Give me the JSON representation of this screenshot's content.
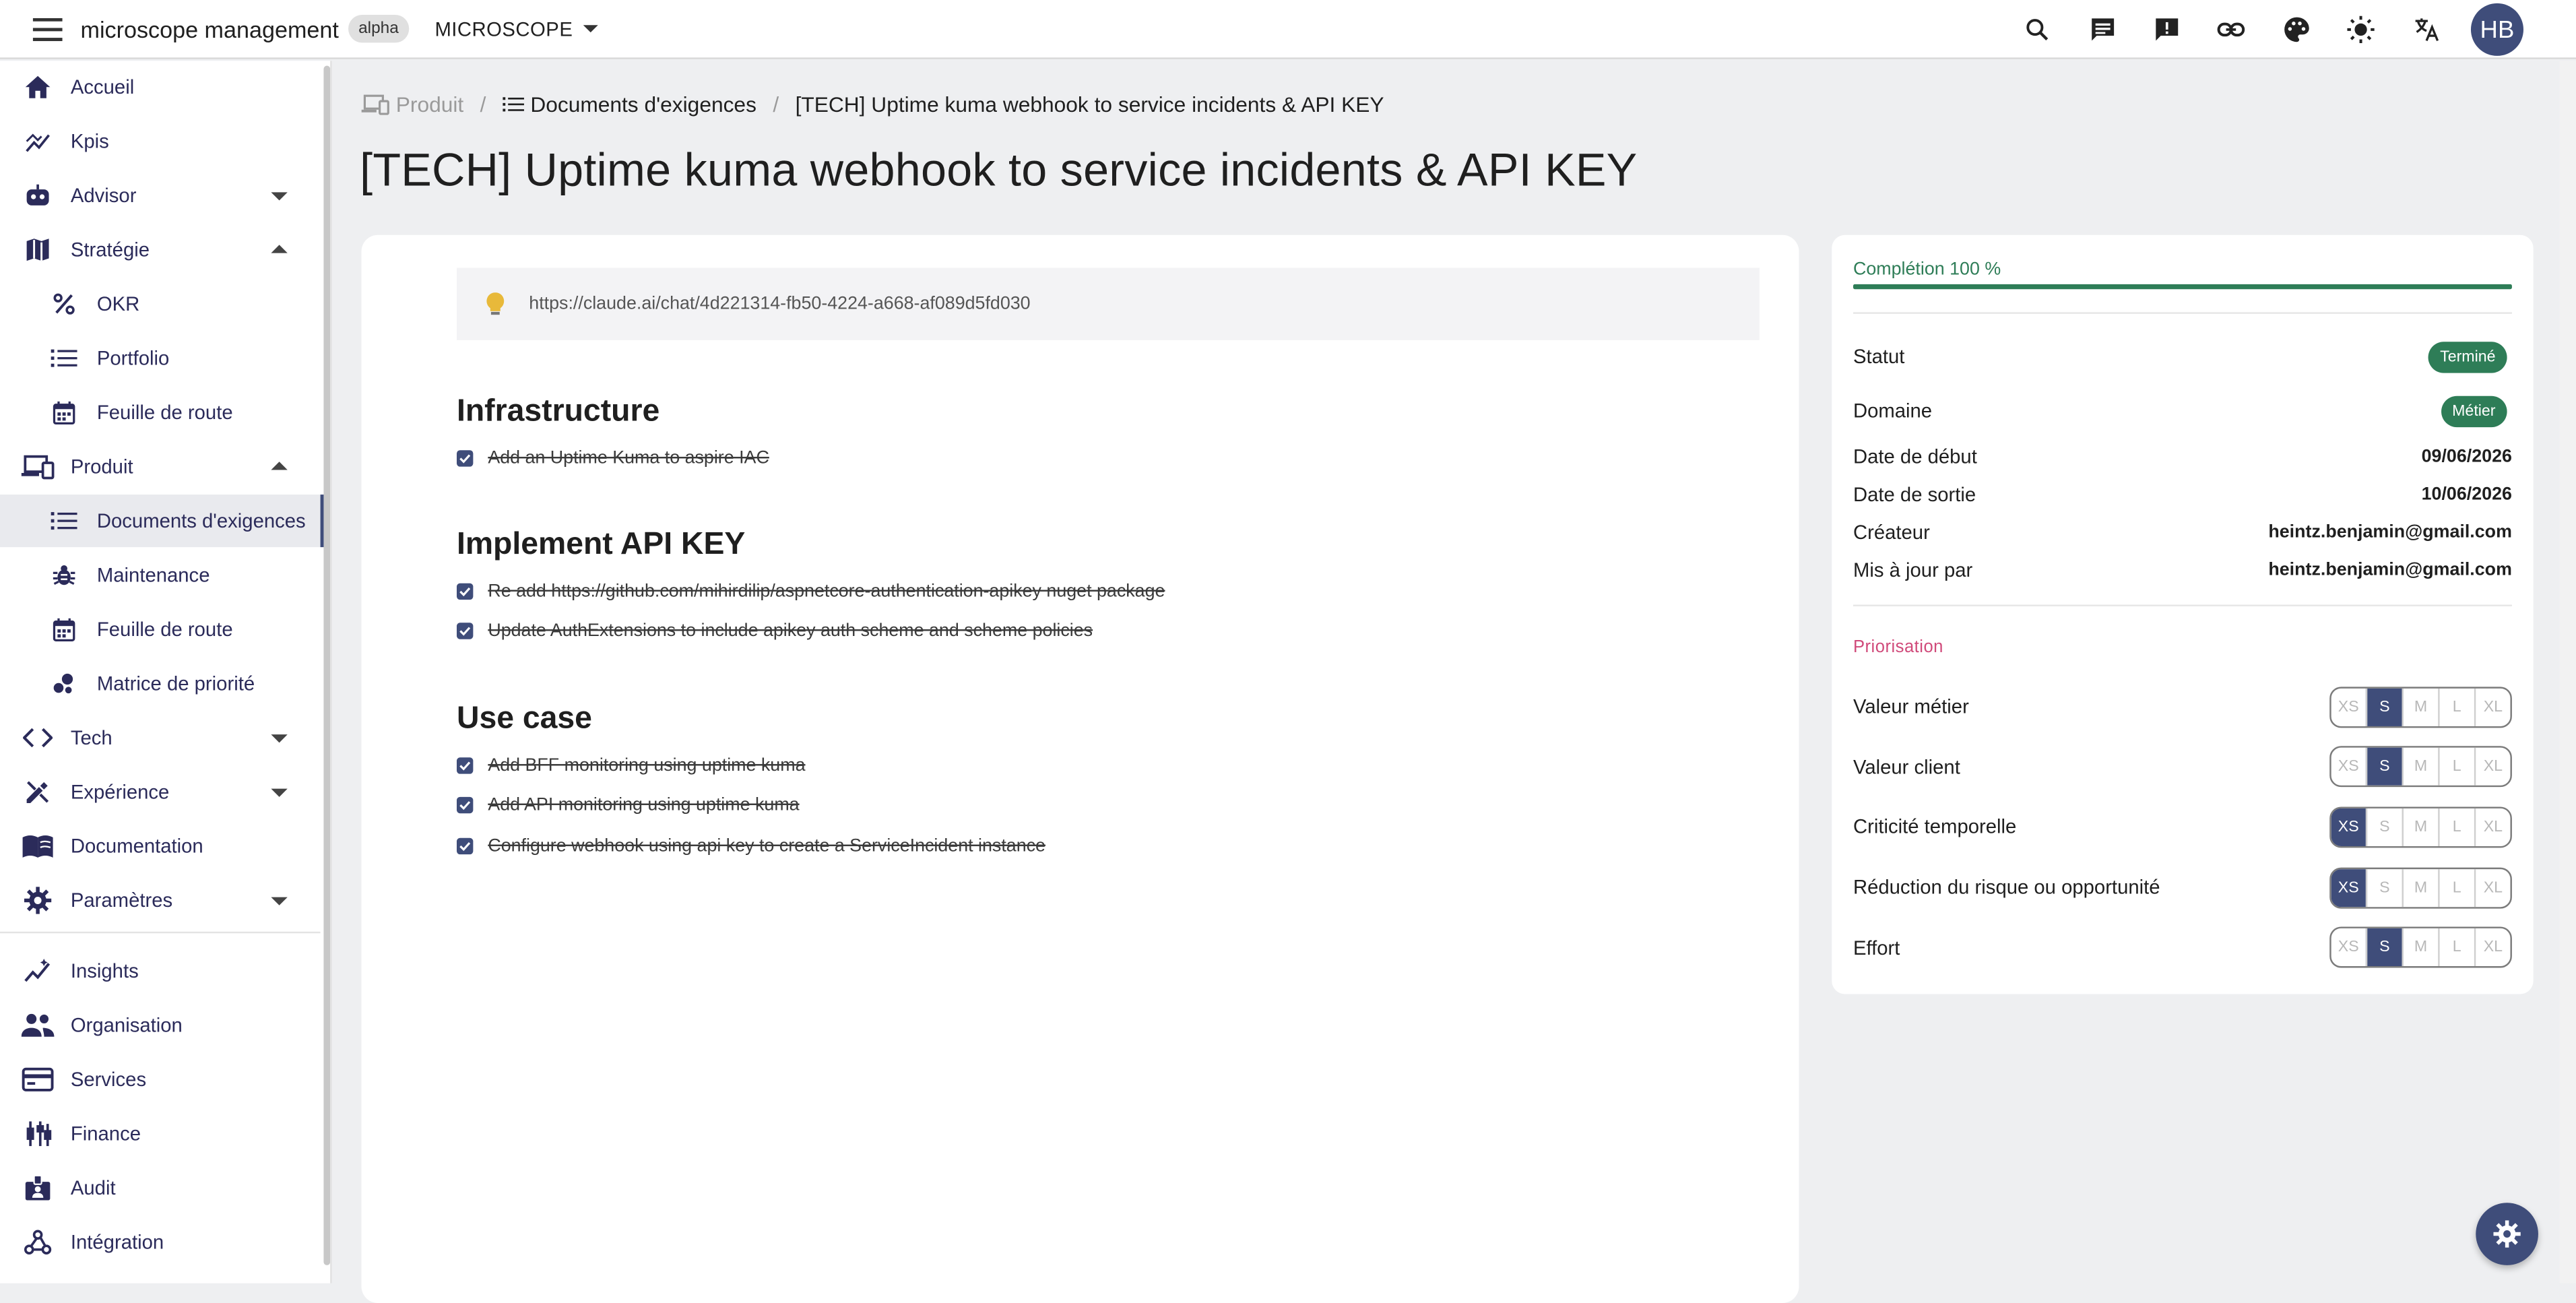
{
  "topbar": {
    "app_title": "microscope management",
    "badge": "alpha",
    "workspace": "MICROSCOPE",
    "avatar_initials": "HB",
    "icons": [
      "search-icon",
      "chat-icon",
      "feedback-icon",
      "link-icon",
      "palette-icon",
      "brightness-icon",
      "translate-icon"
    ]
  },
  "sidebar": {
    "items": [
      {
        "label": "Accueil",
        "icon": "home-icon"
      },
      {
        "label": "Kpis",
        "icon": "chart-line-icon"
      },
      {
        "label": "Advisor",
        "icon": "robot-icon"
      },
      {
        "label": "Stratégie",
        "icon": "map-icon"
      },
      {
        "label": "OKR",
        "icon": "percent-icon"
      },
      {
        "label": "Portfolio",
        "icon": "list-icon"
      },
      {
        "label": "Feuille de route",
        "icon": "calendar-icon"
      },
      {
        "label": "Produit",
        "icon": "devices-icon"
      },
      {
        "label": "Documents d'exigences",
        "icon": "list-icon"
      },
      {
        "label": "Maintenance",
        "icon": "bug-icon"
      },
      {
        "label": "Feuille de route",
        "icon": "calendar-icon"
      },
      {
        "label": "Matrice de priorité",
        "icon": "bubble-chart-icon"
      },
      {
        "label": "Tech",
        "icon": "code-icon"
      },
      {
        "label": "Expérience",
        "icon": "design-icon"
      },
      {
        "label": "Documentation",
        "icon": "book-icon"
      },
      {
        "label": "Paramètres",
        "icon": "gear-icon"
      },
      {
        "label": "Insights",
        "icon": "insights-icon"
      },
      {
        "label": "Organisation",
        "icon": "people-icon"
      },
      {
        "label": "Services",
        "icon": "card-icon"
      },
      {
        "label": "Finance",
        "icon": "candlestick-icon"
      },
      {
        "label": "Audit",
        "icon": "badge-icon"
      },
      {
        "label": "Intégration",
        "icon": "webhook-icon"
      }
    ]
  },
  "breadcrumb": {
    "items": [
      "Produit",
      "Documents d'exigences",
      "[TECH] Uptime kuma webhook to service incidents & API KEY"
    ],
    "separator": "/"
  },
  "page": {
    "title": "[TECH] Uptime kuma webhook to service incidents & API KEY"
  },
  "document": {
    "hint_link": "https://claude.ai/chat/4d221314-fb50-4224-a668-af089d5fd030",
    "sections": [
      {
        "title": "Infrastructure",
        "tasks": [
          "Add an Uptime Kuma to aspire IAC"
        ]
      },
      {
        "title": "Implement API KEY",
        "tasks": [
          "Re add https://github.com/mihirdilip/aspnetcore-authentication-apikey nuget package",
          "Update AuthExtensions to include apikey auth scheme and scheme policies"
        ]
      },
      {
        "title": "Use case",
        "tasks": [
          "Add BFF monitoring using uptime kuma",
          "Add API monitoring using uptime kuma",
          "Configure webhook using api key to create a ServiceIncident instance"
        ]
      }
    ]
  },
  "details": {
    "completion_label": "Complétion 100 %",
    "completion_value": 100,
    "statut_label": "Statut",
    "statut_value": "Terminé",
    "domaine_label": "Domaine",
    "domaine_value": "Métier",
    "start_label": "Date de début",
    "start_value": "09/06/2026",
    "end_label": "Date de sortie",
    "end_value": "10/06/2026",
    "creator_label": "Créateur",
    "creator_value": "heintz.benjamin@gmail.com",
    "updated_label": "Mis à jour par",
    "updated_value": "heintz.benjamin@gmail.com"
  },
  "prioritization": {
    "heading": "Priorisation",
    "size_options": [
      "XS",
      "S",
      "M",
      "L",
      "XL"
    ],
    "rows": [
      {
        "label": "Valeur métier",
        "selected": "S"
      },
      {
        "label": "Valeur client",
        "selected": "S"
      },
      {
        "label": "Criticité temporelle",
        "selected": "XS"
      },
      {
        "label": "Réduction du risque ou opportunité",
        "selected": "XS"
      },
      {
        "label": "Effort",
        "selected": "S"
      }
    ]
  },
  "colors": {
    "primary": "#3f4d7a",
    "success": "#2e7d57",
    "accent_pink": "#d04a7a",
    "background": "#eeeff1"
  }
}
